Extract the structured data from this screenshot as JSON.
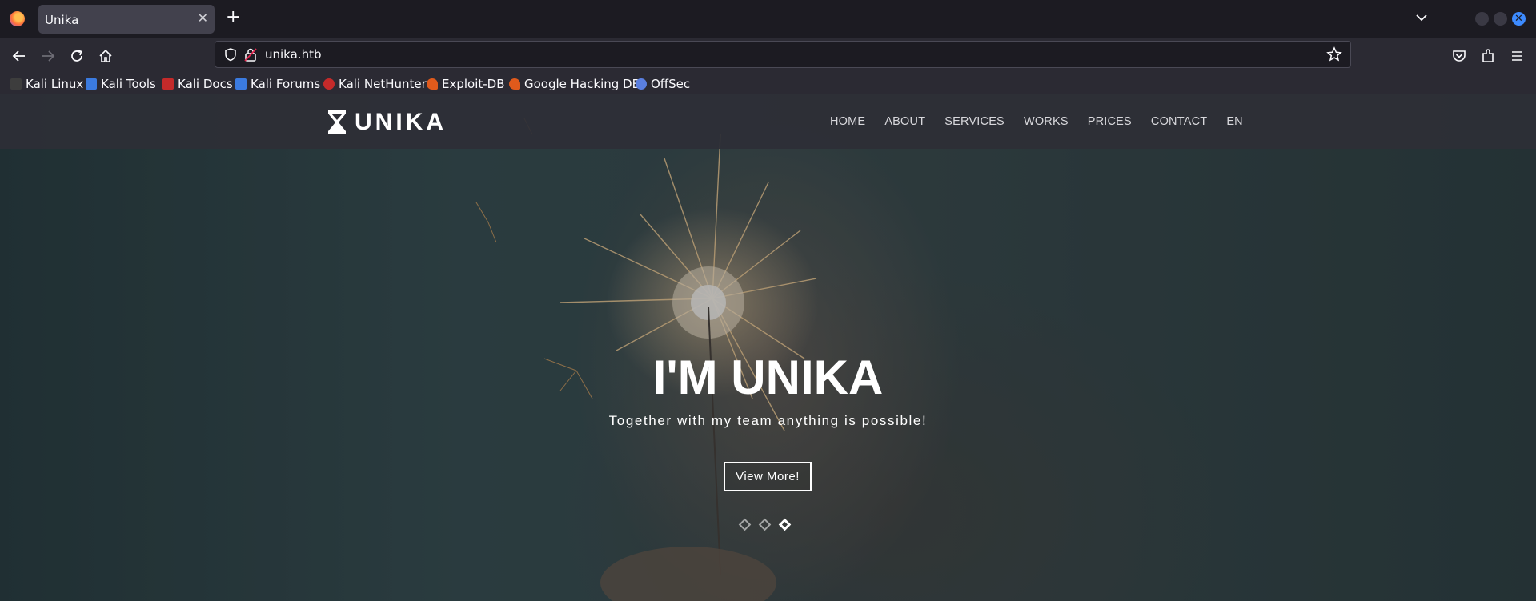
{
  "browser": {
    "tab_title": "Unika",
    "url": "unika.htb",
    "bookmarks": [
      {
        "label": "Kali Linux",
        "color": "#3d3d3d"
      },
      {
        "label": "Kali Tools",
        "color": "#3b7be0"
      },
      {
        "label": "Kali Docs",
        "color": "#c42a2a"
      },
      {
        "label": "Kali Forums",
        "color": "#3b7be0"
      },
      {
        "label": "Kali NetHunter",
        "color": "#c42a2a"
      },
      {
        "label": "Exploit-DB",
        "color": "#e05a1c"
      },
      {
        "label": "Google Hacking DB",
        "color": "#e05a1c"
      },
      {
        "label": "OffSec",
        "color": "#5a7fe0"
      }
    ]
  },
  "site": {
    "logo_text": "UNIKA",
    "menu": [
      "HOME",
      "ABOUT",
      "SERVICES",
      "WORKS",
      "PRICES",
      "CONTACT",
      "EN"
    ],
    "hero": {
      "title": "I'M UNIKA",
      "subtitle": "Together with my team anything is possible!",
      "button_label": "View More!"
    },
    "slider_active_index": 2
  },
  "colors": {
    "browser_bg": "#1c1b22",
    "toolbar_bg": "#2b2a33",
    "accent_blue": "#3d8bff"
  }
}
